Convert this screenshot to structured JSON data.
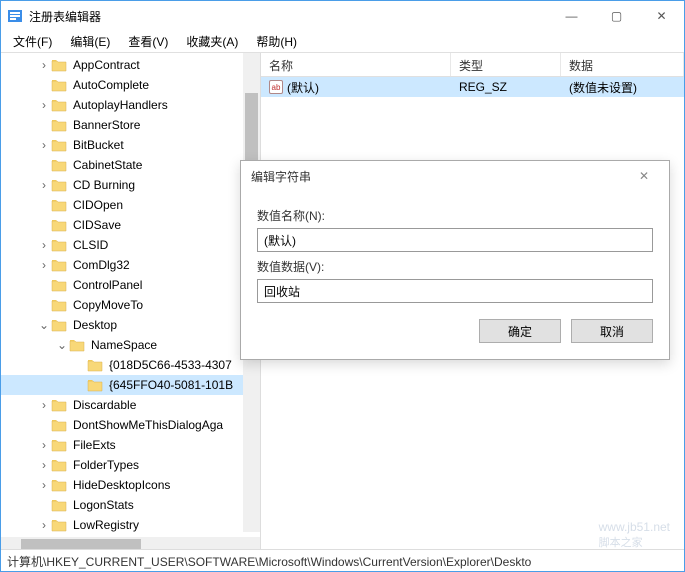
{
  "window": {
    "title": "注册表编辑器",
    "controls": {
      "min": "—",
      "max": "▢",
      "close": "✕"
    }
  },
  "menu": {
    "file": "文件(F)",
    "edit": "编辑(E)",
    "view": "查看(V)",
    "favorites": "收藏夹(A)",
    "help": "帮助(H)"
  },
  "tree": {
    "items": [
      {
        "label": "AppContract",
        "depth": 2,
        "expander": "›"
      },
      {
        "label": "AutoComplete",
        "depth": 2,
        "expander": ""
      },
      {
        "label": "AutoplayHandlers",
        "depth": 2,
        "expander": "›"
      },
      {
        "label": "BannerStore",
        "depth": 2,
        "expander": ""
      },
      {
        "label": "BitBucket",
        "depth": 2,
        "expander": "›"
      },
      {
        "label": "CabinetState",
        "depth": 2,
        "expander": ""
      },
      {
        "label": "CD Burning",
        "depth": 2,
        "expander": "›"
      },
      {
        "label": "CIDOpen",
        "depth": 2,
        "expander": ""
      },
      {
        "label": "CIDSave",
        "depth": 2,
        "expander": ""
      },
      {
        "label": "CLSID",
        "depth": 2,
        "expander": "›"
      },
      {
        "label": "ComDlg32",
        "depth": 2,
        "expander": "›"
      },
      {
        "label": "ControlPanel",
        "depth": 2,
        "expander": ""
      },
      {
        "label": "CopyMoveTo",
        "depth": 2,
        "expander": ""
      },
      {
        "label": "Desktop",
        "depth": 2,
        "expander": "⌄",
        "expanded": true
      },
      {
        "label": "NameSpace",
        "depth": 3,
        "expander": "⌄",
        "expanded": true
      },
      {
        "label": "{018D5C66-4533-4307",
        "depth": 4,
        "expander": ""
      },
      {
        "label": "{645FFO40-5081-101B",
        "depth": 4,
        "expander": "",
        "selected": true
      },
      {
        "label": "Discardable",
        "depth": 2,
        "expander": "›"
      },
      {
        "label": "DontShowMeThisDialogAga",
        "depth": 2,
        "expander": ""
      },
      {
        "label": "FileExts",
        "depth": 2,
        "expander": "›"
      },
      {
        "label": "FolderTypes",
        "depth": 2,
        "expander": "›"
      },
      {
        "label": "HideDesktopIcons",
        "depth": 2,
        "expander": "›"
      },
      {
        "label": "LogonStats",
        "depth": 2,
        "expander": ""
      },
      {
        "label": "LowRegistry",
        "depth": 2,
        "expander": "›"
      }
    ]
  },
  "list": {
    "headers": {
      "name": "名称",
      "type": "类型",
      "data": "数据"
    },
    "rows": [
      {
        "name": "(默认)",
        "type": "REG_SZ",
        "data": "(数值未设置)",
        "selected": true
      }
    ]
  },
  "dialog": {
    "title": "编辑字符串",
    "name_label": "数值名称(N):",
    "name_value": "(默认)",
    "data_label": "数值数据(V):",
    "data_value": "回收站",
    "ok": "确定",
    "cancel": "取消"
  },
  "statusbar": "计算机\\HKEY_CURRENT_USER\\SOFTWARE\\Microsoft\\Windows\\CurrentVersion\\Explorer\\Deskto",
  "watermark": {
    "domain": "www.jb51.net",
    "site": "脚本之家"
  }
}
